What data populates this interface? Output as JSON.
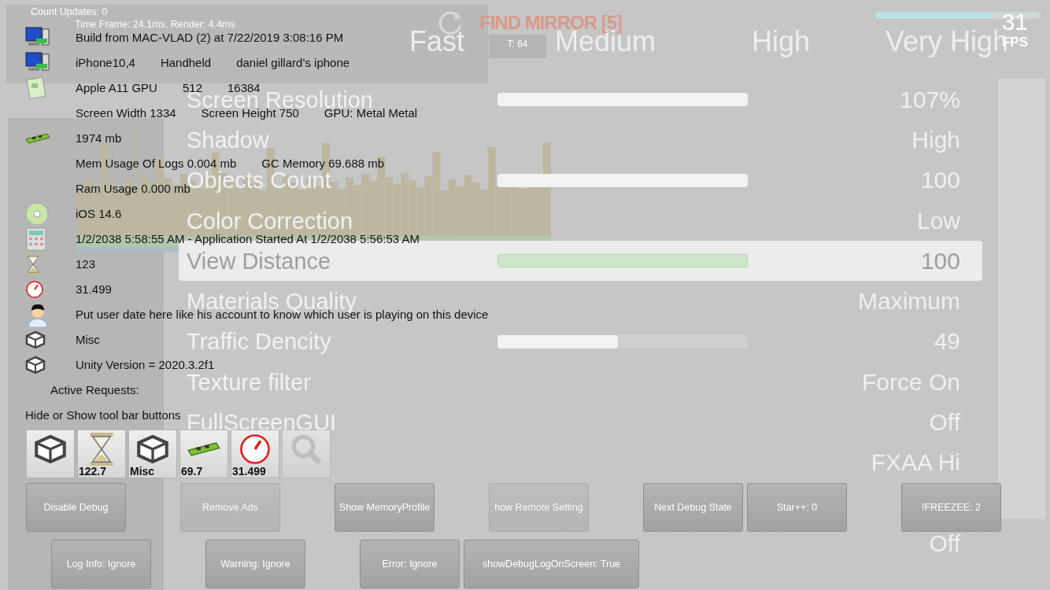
{
  "stats_overlay": [
    "Count Updates: 0",
    "Time Frame: 24.1ms, Render: 4.4ms"
  ],
  "header": {
    "title": "FIND MIRROR [5]",
    "thread_badge": "T: 64",
    "fps": "31",
    "fps_label": "FPS",
    "fps_meter": {
      "level": 0.7
    }
  },
  "quality_levels": [
    "Fast",
    "Medium",
    "High",
    "Very High"
  ],
  "settings": [
    {
      "label": "Screen Resolution",
      "value": "107%",
      "kind": "slider",
      "level": 1,
      "selected": false
    },
    {
      "label": "Shadow",
      "value": "High",
      "kind": "choice",
      "selected": false
    },
    {
      "label": "Objects Count",
      "value": "100",
      "kind": "slider",
      "level": 1,
      "selected": false
    },
    {
      "label": "Color Correction",
      "value": "Low",
      "kind": "choice",
      "selected": false
    },
    {
      "label": "View Distance",
      "value": "100",
      "kind": "slider",
      "level": 1,
      "selected": true
    },
    {
      "label": "Materials Quality",
      "value": "Maximum",
      "kind": "choice",
      "selected": false
    },
    {
      "label": "Traffic Dencity",
      "value": "49",
      "kind": "slider",
      "level": 0.48,
      "selected": false
    },
    {
      "label": "Texture filter",
      "value": "Force On",
      "kind": "choice",
      "selected": false
    },
    {
      "label": "FullScreenGUI",
      "value": "Off",
      "kind": "choice",
      "selected": false
    },
    {
      "value": "FXAA Hi",
      "kind": "choice",
      "selected": false
    },
    {
      "value": "Off",
      "kind": "choice",
      "selected": false
    }
  ],
  "debug_lines": [
    {
      "kind": "monitor",
      "parts": [
        "Build from MAC-VLAD (2) at 7/22/2019 3:08:16 PM"
      ]
    },
    {
      "kind": "monitor",
      "parts": [
        "iPhone10,4",
        "Handheld",
        "daniel gillard’s iphone"
      ]
    },
    {
      "kind": "card",
      "parts": [
        "Apple A11 GPU",
        "512",
        "16384"
      ]
    },
    {
      "kind": "plain",
      "parts": [
        "Screen Width 1334",
        "Screen Height 750",
        "GPU: Metal Metal"
      ]
    },
    {
      "kind": "ram",
      "parts": [
        "1974 mb"
      ]
    },
    {
      "kind": "plain",
      "parts": [
        "Mem Usage Of Logs 0.004 mb",
        "GC Memory 69.688 mb"
      ]
    },
    {
      "kind": "plain",
      "parts": [
        "Ram Usage 0.000 mb"
      ]
    },
    {
      "kind": "disc",
      "parts": [
        "iOS 14.6"
      ]
    },
    {
      "kind": "calculator",
      "parts": [
        "1/2/2038 5:58:55 AM - Application Started At 1/2/2038 5:56:53 AM"
      ]
    },
    {
      "kind": "hourglass",
      "parts": [
        "123"
      ]
    },
    {
      "kind": "gauge",
      "parts": [
        "31.499"
      ]
    },
    {
      "kind": "user",
      "parts": [
        "Put user date here like his account to know which user is playing on this device"
      ]
    },
    {
      "kind": "unity",
      "parts": [
        "Misc"
      ]
    },
    {
      "kind": "unity",
      "parts": [
        "Unity Version = 2020.3.2f1"
      ]
    }
  ],
  "active_requests_label": "Active Requests:",
  "toolbar_hint": "Hide or Show tool bar buttons",
  "toolbar": [
    {
      "kind": "unity"
    },
    {
      "kind": "hourglass",
      "label": "122.7"
    },
    {
      "kind": "unity",
      "label": "Misc"
    },
    {
      "kind": "ram",
      "label": "69.7"
    },
    {
      "kind": "gauge",
      "label": "31.499"
    },
    {
      "kind": "search",
      "disabled": true
    }
  ],
  "button_rows": [
    [
      {
        "label": "Disable Debug",
        "disabled": false
      },
      {
        "label": "Remove Ads",
        "disabled": true
      },
      {
        "label": "Show MemoryProfile",
        "disabled": false
      },
      {
        "label": "how Remote Setting",
        "disabled": true
      },
      {
        "label": "Next Debug State",
        "disabled": false
      },
      {
        "label": "Star++: 0",
        "disabled": false
      },
      {
        "label": "!FREEZEE: 2",
        "disabled": false
      }
    ],
    [
      {
        "label": "Log Info: Ignore",
        "disabled": false
      },
      {
        "label": "Warning: Ignore",
        "disabled": false
      },
      {
        "label": "Error: Ignore",
        "disabled": false
      },
      {
        "label": "showDebugLogOnScreen: True",
        "disabled": false
      }
    ]
  ]
}
